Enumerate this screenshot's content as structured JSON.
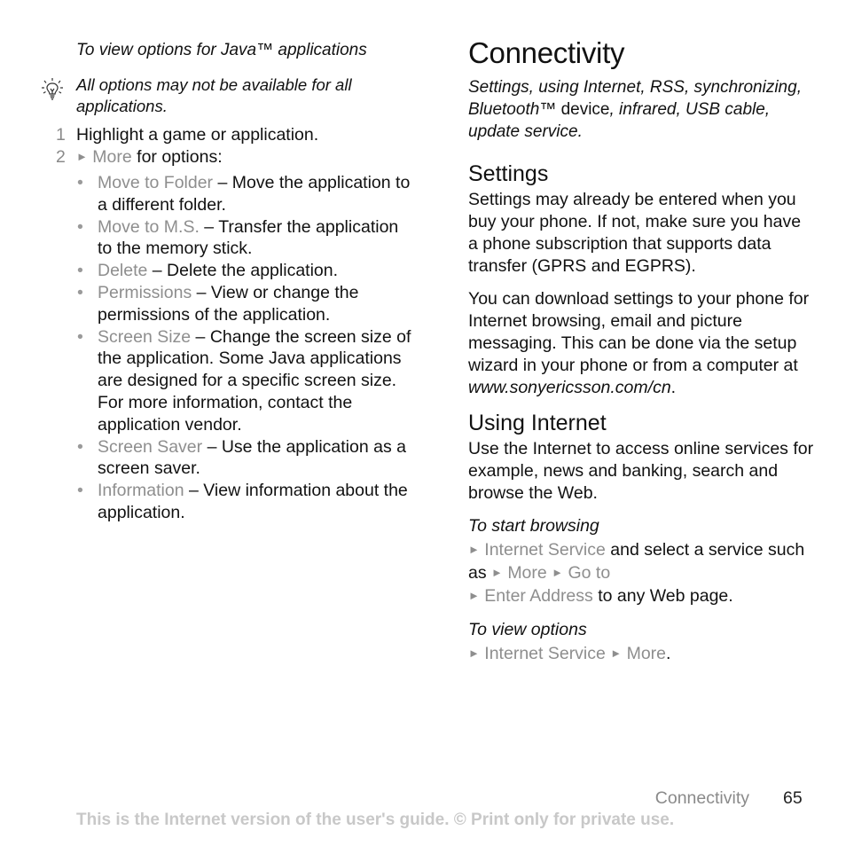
{
  "left": {
    "procedure_title": "To view options for Java™ applications",
    "note_icon": "lightbulb-tip-icon",
    "note": "All options may not be available for all applications.",
    "steps": [
      {
        "num": "1",
        "text": "Highlight a game or application."
      },
      {
        "num": "2",
        "arrow": "►",
        "menu": "More",
        "text": " for options:"
      }
    ],
    "options": [
      {
        "label": "Move to Folder",
        "desc": " – Move the application to a different folder."
      },
      {
        "label": "Move to M.S.",
        "desc": " – Transfer the application to the memory stick."
      },
      {
        "label": "Delete",
        "desc": " – Delete the application."
      },
      {
        "label": "Permissions",
        "desc": " – View or change the permissions of the application."
      },
      {
        "label": "Screen Size",
        "desc": " – Change the screen size of the application. Some Java applications are designed for a specific screen size. For more information, contact the application vendor."
      },
      {
        "label": "Screen Saver",
        "desc": " – Use the application as a screen saver."
      },
      {
        "label": "Information",
        "desc": " – View information about the application."
      }
    ]
  },
  "right": {
    "chapter_title": "Connectivity",
    "intro_italic_1": "Settings, using Internet, RSS, synchronizing, Bluetooth™",
    "intro_upright": " device",
    "intro_italic_2": ", infrared, USB cable, update service.",
    "settings": {
      "heading": "Settings",
      "para1": "Settings may already be entered when you buy your phone. If not, make sure you have a phone subscription that supports data transfer (GPRS and EGPRS).",
      "para2": "You can download settings to your phone for Internet browsing, email and picture messaging. This can be done via the setup wizard in your phone or from a computer at ",
      "url": "www.sonyericsson.com/cn",
      "para2_end": "."
    },
    "internet": {
      "heading": "Using Internet",
      "para": "Use the Internet to access online services for example, news and banking, search and browse the Web.",
      "start_title": "To start browsing",
      "start": {
        "arrow": "►",
        "menu1": "Internet Service",
        "text1": " and select a service such as ",
        "menu2": "More",
        "menu3": "Go to",
        "menu4": "Enter Address",
        "text2": " to any Web page."
      },
      "options_title": "To view options",
      "options": {
        "arrow": "►",
        "menu1": "Internet Service",
        "menu2": "More",
        "end": "."
      }
    }
  },
  "footer": {
    "section": "Connectivity",
    "page": "65",
    "notice": "This is the Internet version of the user's guide. © Print only for private use."
  }
}
